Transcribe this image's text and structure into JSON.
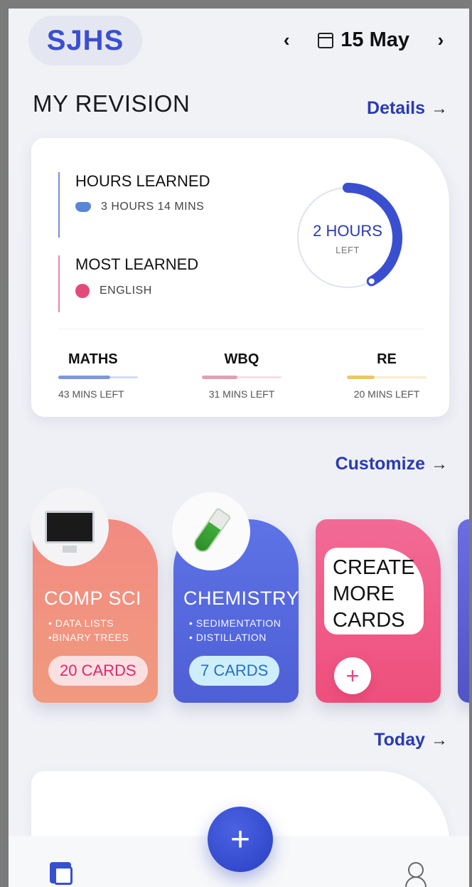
{
  "header": {
    "logo": "SJHS",
    "prev_label": "‹",
    "next_label": "›",
    "date": "15 May"
  },
  "revision": {
    "title": "MY REVISION",
    "details_link": "Details",
    "hours_learned": {
      "label": "HOURS LEARNED",
      "value": "3 HOURS 14 MINS"
    },
    "most_learned": {
      "label": "MOST LEARNED",
      "value": "ENGLISH"
    },
    "ring": {
      "main": "2 HOURS",
      "sub": "LEFT",
      "progress": 0.42
    },
    "subjects": [
      {
        "name": "MATHS",
        "left": "43 MINS LEFT",
        "progress": 0.65,
        "color": "#7f97e0"
      },
      {
        "name": "WBQ",
        "left": "31 MINS LEFT",
        "progress": 0.45,
        "color": "#e2a0b0"
      },
      {
        "name": "RE",
        "left": "20 MINS LEFT",
        "progress": 0.35,
        "color": "#e9c86a"
      }
    ]
  },
  "cards": {
    "customize_link": "Customize",
    "items": [
      {
        "title": "COMP SCI",
        "topics": [
          "• DATA LISTS",
          "•BINARY TREES"
        ],
        "count": "20 CARDS",
        "icon": "computer-monitor"
      },
      {
        "title": "CHEMISTRY",
        "topics": [
          "• SEDIMENTATION",
          "• DISTILLATION"
        ],
        "count": "7 CARDS",
        "icon": "test-tube"
      }
    ],
    "create": {
      "lines": [
        "CREATE",
        "MORE",
        "CARDS"
      ],
      "plus": "+"
    }
  },
  "today_link": "Today",
  "fab_label": "+",
  "colors": {
    "accent": "#2a3ab2",
    "compsci": "#f28b82",
    "chemistry": "#5d73e6",
    "create": "#ee4f7c"
  }
}
